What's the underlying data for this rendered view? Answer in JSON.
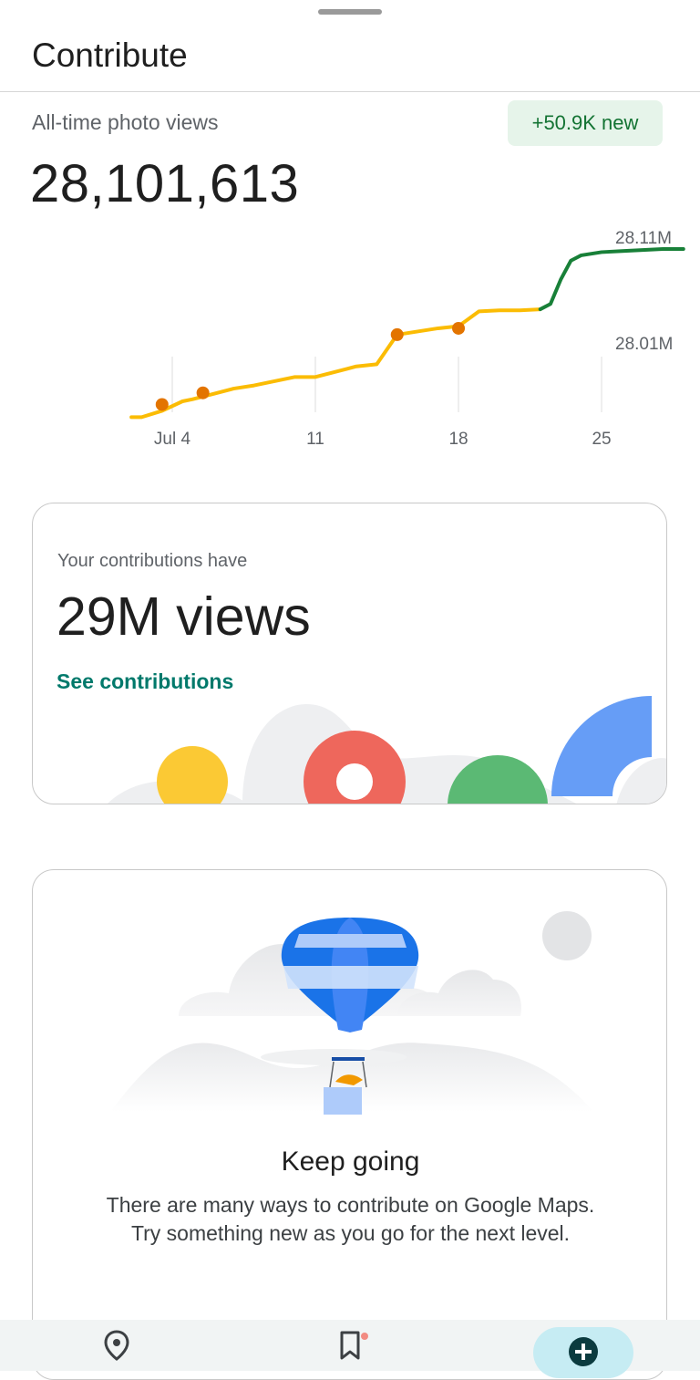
{
  "header": {
    "title": "Contribute"
  },
  "stats": {
    "label": "All-time photo views",
    "badge": "+50.9K new",
    "total": "28,101,613"
  },
  "chart_data": {
    "type": "line",
    "x_tick_labels": [
      "Jul 4",
      "11",
      "18",
      "25"
    ],
    "y_tick_labels": [
      "28.11M",
      "28.01M"
    ],
    "ylim_M": [
      27.94,
      28.11
    ],
    "series": [
      {
        "color": "#fbbc04",
        "x_day": [
          -2,
          -1.5,
          -0.5,
          0.5,
          1,
          2,
          3,
          4,
          5,
          6,
          7,
          8,
          9,
          10,
          11,
          12,
          13,
          14,
          15,
          16,
          17,
          18
        ],
        "values_M": [
          27.945,
          27.945,
          27.951,
          27.96,
          27.962,
          27.967,
          27.972,
          27.975,
          27.979,
          27.983,
          27.983,
          27.988,
          27.993,
          27.995,
          28.023,
          28.026,
          28.029,
          28.031,
          28.045,
          28.046,
          28.046,
          28.047
        ]
      },
      {
        "color": "#188038",
        "x_day": [
          18,
          18.5,
          19,
          19.5,
          20,
          21,
          22,
          23,
          24,
          25
        ],
        "values_M": [
          28.047,
          28.052,
          28.075,
          28.093,
          28.098,
          28.101,
          28.102,
          28.103,
          28.104,
          28.104
        ]
      }
    ],
    "markers": {
      "color": "#e37400",
      "x_day": [
        -0.5,
        1.5,
        11,
        14
      ],
      "values_M": [
        27.957,
        27.968,
        28.023,
        28.029
      ]
    }
  },
  "contributions_card": {
    "subtitle": "Your contributions have",
    "headline": "29M views",
    "link": "See contributions"
  },
  "level_card": {
    "title": "Keep going",
    "body": "There are many ways to contribute on Google Maps. Try something new as you go for the next level."
  },
  "bottom_nav": {
    "items": [
      {
        "icon": "location-pin-icon"
      },
      {
        "icon": "bookmark-icon"
      },
      {
        "icon": "add-circle-icon"
      }
    ]
  },
  "colors": {
    "accent_teal": "#00796b",
    "badge_bg": "#e6f4ea",
    "badge_text": "#137333"
  }
}
